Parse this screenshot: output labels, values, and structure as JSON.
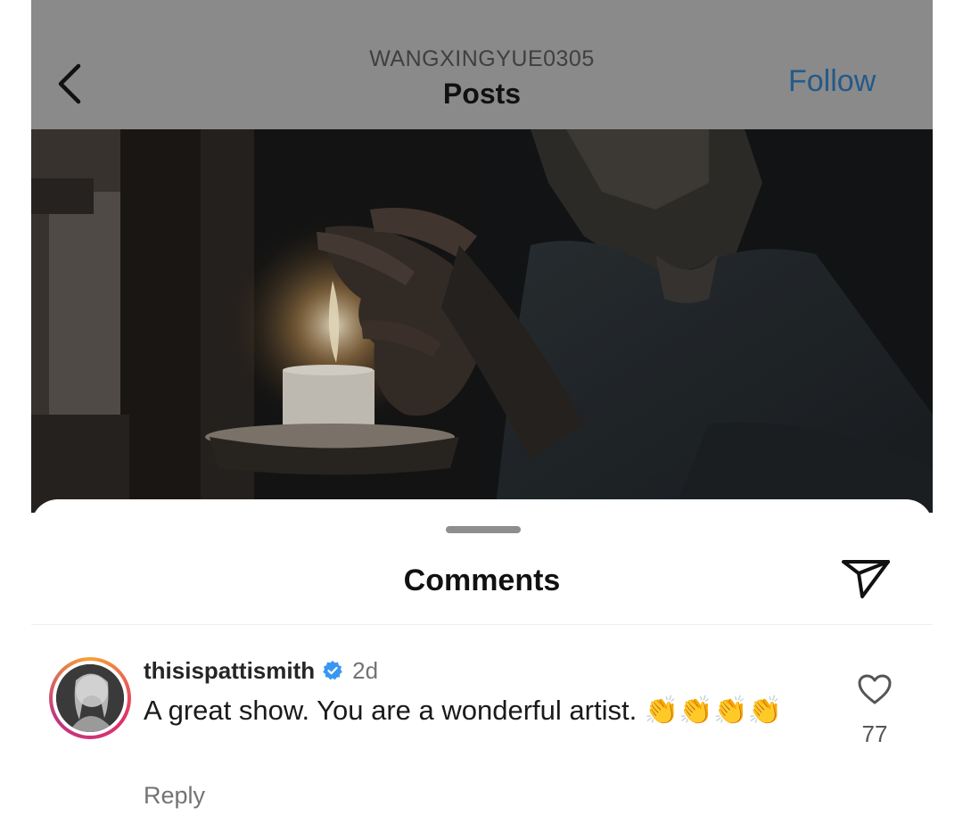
{
  "header": {
    "username": "WANGXINGYUE0305",
    "title": "Posts",
    "follow_label": "Follow",
    "back_icon": "chevron-left-icon"
  },
  "comments_sheet": {
    "title": "Comments",
    "share_icon": "paper-plane-icon"
  },
  "comment": {
    "username": "thisispattismith",
    "verified": true,
    "time": "2d",
    "text": "A great show. You are a wonderful artist. 👏👏👏👏",
    "reply_label": "Reply",
    "like_count": "77",
    "like_icon": "heart-outline-icon"
  },
  "colors": {
    "follow": "#245a88",
    "verified_badge": "#3897f0",
    "header_overlay": "#8a8a8a"
  }
}
